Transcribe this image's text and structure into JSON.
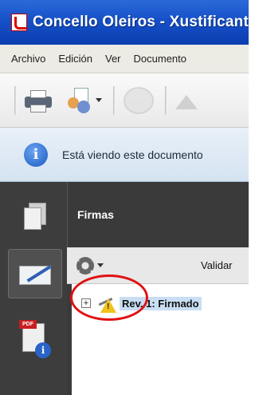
{
  "window": {
    "title": "Concello Oleiros - Xustificante"
  },
  "menubar": {
    "items": [
      "Archivo",
      "Edición",
      "Ver",
      "Documento"
    ]
  },
  "toolbar": {
    "buttons": [
      "printer-icon",
      "share-icon",
      "comment-icon",
      "up-arrow-icon"
    ]
  },
  "infobar": {
    "text": "Está viendo este documento"
  },
  "nav": {
    "items": [
      "pages-icon",
      "signatures-icon",
      "security-icon"
    ]
  },
  "security_icon": {
    "badge": "PDF",
    "info_glyph": "i"
  },
  "panel": {
    "title": "Firmas",
    "validate_all": "Validar",
    "signature": {
      "expand": "+",
      "label": "Rev. 1: Firmado"
    }
  },
  "colors": {
    "titlebar": "#1650c8",
    "highlight_circle": "#e01212",
    "selection": "#c9def3",
    "warning": "#f1c21b"
  }
}
